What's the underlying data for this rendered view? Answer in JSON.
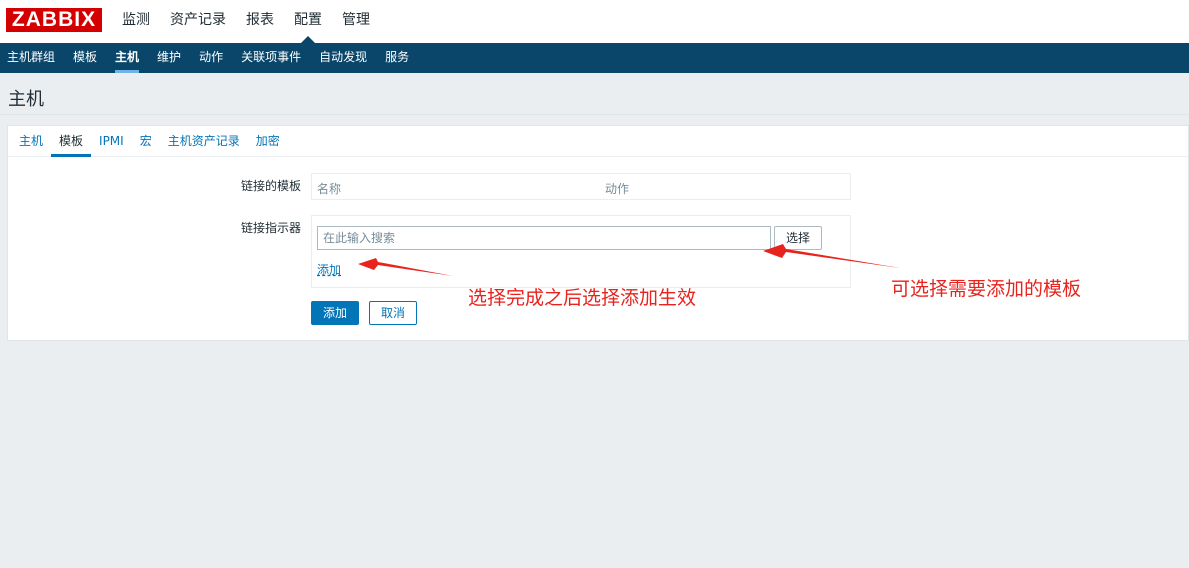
{
  "logo": "ZABBIX",
  "top_menu": [
    "监测",
    "资产记录",
    "报表",
    "配置",
    "管理"
  ],
  "sub_menu": [
    "主机群组",
    "模板",
    "主机",
    "维护",
    "动作",
    "关联项事件",
    "自动发现",
    "服务"
  ],
  "page_title": "主机",
  "tabs": [
    "主机",
    "模板",
    "IPMI",
    "宏",
    "主机资产记录",
    "加密"
  ],
  "form": {
    "linked_templates_label": "链接的模板",
    "col_name": "名称",
    "col_action": "动作",
    "link_indicator_label": "链接指示器",
    "search_placeholder": "在此输入搜索",
    "select_button": "选择",
    "add_link": "添加",
    "submit_button": "添加",
    "cancel_button": "取消"
  },
  "annotations": {
    "left": "选择完成之后选择添加生效",
    "right": "可选择需要添加的模板",
    "color": "#e8231e"
  }
}
